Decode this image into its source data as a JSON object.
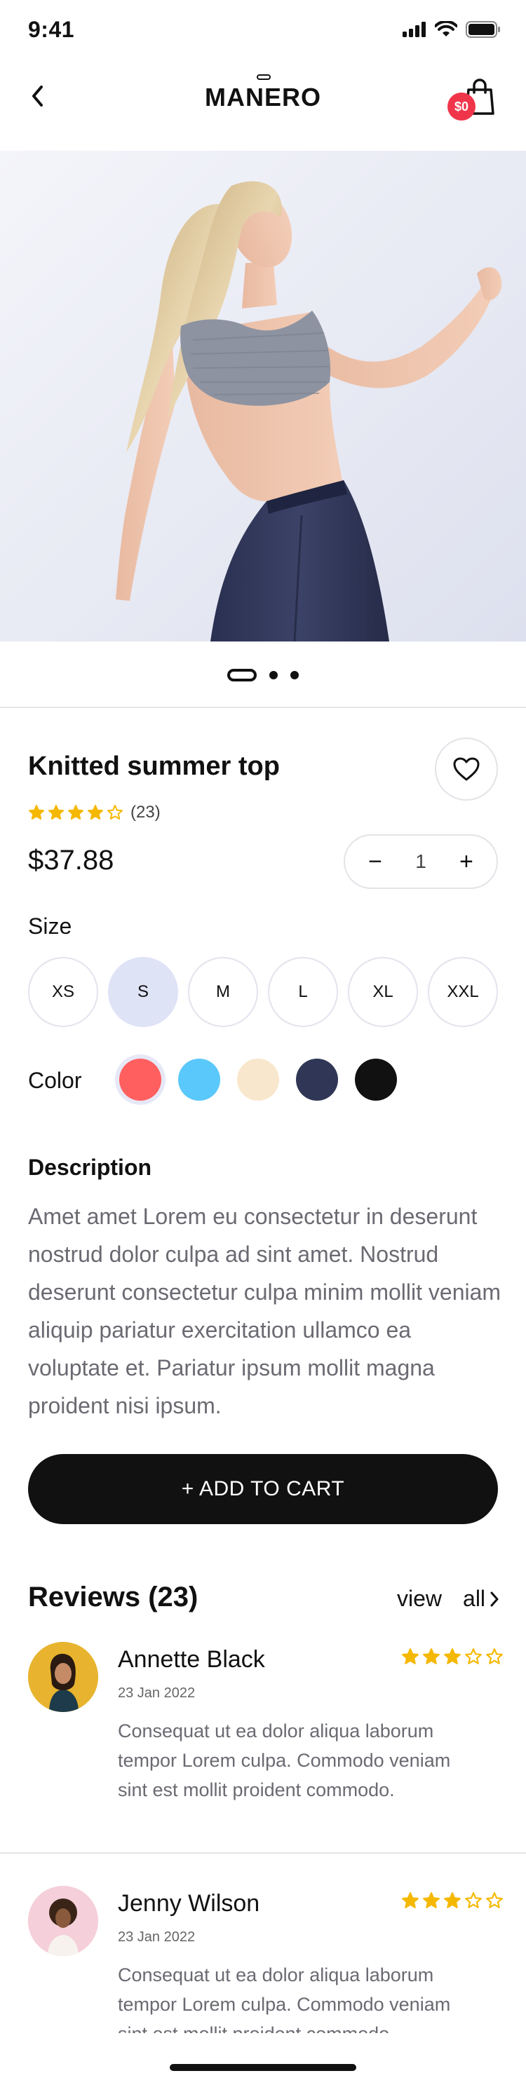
{
  "status": {
    "time": "9:41"
  },
  "header": {
    "brand": "MANERO",
    "cart_amount": "$0"
  },
  "product": {
    "title": "Knitted summer top",
    "rating_stars": 4,
    "rating_count": "(23)",
    "price": "$37.88",
    "quantity": "1",
    "qty_minus": "−",
    "qty_plus": "+"
  },
  "gallery": {
    "pages": 3,
    "active_page": 1
  },
  "size": {
    "label": "Size",
    "options": [
      "XS",
      "S",
      "M",
      "L",
      "XL",
      "XXL"
    ],
    "selected": "S"
  },
  "color": {
    "label": "Color",
    "options": [
      "#ff5f5f",
      "#5ac8fa",
      "#f8e7cc",
      "#2f3656",
      "#111111"
    ],
    "selected_index": 0
  },
  "description": {
    "title": "Description",
    "text": "Amet amet Lorem eu consectetur in deserunt nostrud dolor culpa ad sint amet. Nostrud deserunt consectetur culpa minim mollit veniam aliquip pariatur exercitation ullamco ea voluptate et. Pariatur ipsum mollit magna proident nisi ipsum."
  },
  "cta": {
    "label": "+ ADD TO CART"
  },
  "reviews": {
    "title": "Reviews (23)",
    "view_all": "view",
    "view_all_2": "all",
    "items": [
      {
        "name": "Annette Black",
        "date": "23 Jan 2022",
        "stars": 3,
        "text": "Consequat ut ea dolor aliqua laborum tempor Lorem culpa. Commodo veniam sint est mollit proident commodo."
      },
      {
        "name": "Jenny Wilson",
        "date": "23 Jan 2022",
        "stars": 3,
        "text": "Consequat ut ea dolor aliqua laborum tempor Lorem culpa. Commodo veniam sint est mollit proident commodo."
      }
    ]
  },
  "colors_theme": {
    "star": "#f5b800",
    "badge": "#f0354b",
    "selected_size": "#dfe3f6",
    "text_muted": "#6a6a72"
  }
}
